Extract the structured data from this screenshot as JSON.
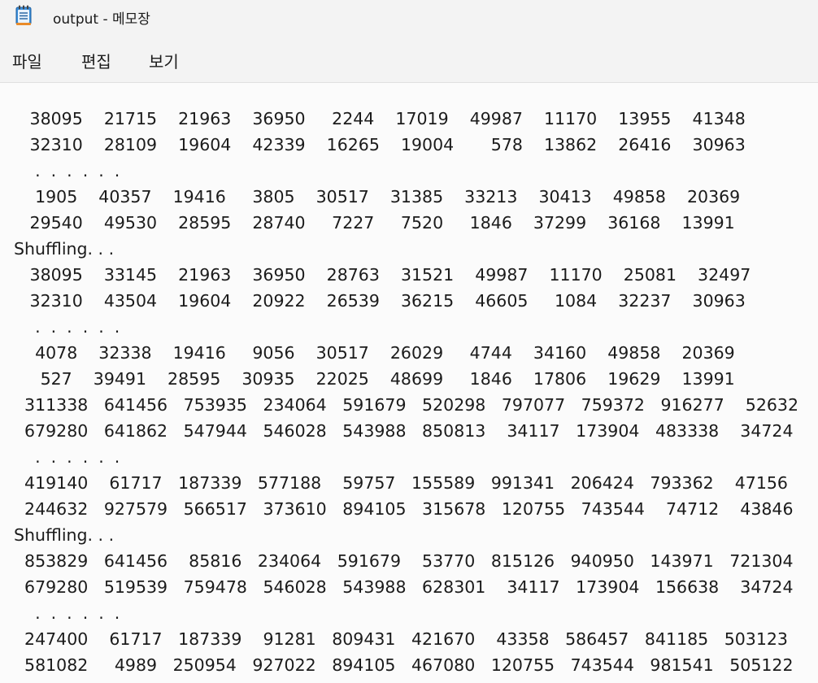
{
  "window": {
    "title": "output - 메모장",
    "icon": "notepad-icon"
  },
  "menu": {
    "file": "파일",
    "edit": "편집",
    "view": "보기"
  },
  "document": {
    "lines": [
      "   38095    21715    21963    36950     2244    17019    49987    11170    13955    41348",
      "   32310    28109    19604    42339    16265    19004       578    13862    26416    30963",
      "    .  .  .  .  .  .",
      "    1905    40357    19416     3805    30517    31385    33213    30413    49858    20369",
      "   29540    49530    28595    28740     7227     7520     1846    37299    36168    13991",
      "Shuffling. . .",
      "   38095    33145    21963    36950    28763    31521    49987    11170    25081    32497",
      "   32310    43504    19604    20922    26539    36215    46605     1084    32237    30963",
      "    .  .  .  .  .  .",
      "    4078    32338    19416     9056    30517    26029     4744    34160    49858    20369",
      "     527    39491    28595    30935    22025    48699     1846    17806    19629    13991",
      "  311338   641456   753935   234064   591679   520298   797077   759372   916277    52632",
      "  679280   641862   547944   546028   543988   850813    34117   173904   483338    34724",
      "    .  .  .  .  .  .",
      "  419140    61717   187339   577188    59757   155589   991341   206424   793362    47156",
      "  244632   927579   566517   373610   894105   315678   120755   743544    74712    43846",
      "Shuffling. . .",
      "  853829   641456    85816   234064   591679    53770   815126   940950   143971   721304",
      "  679280   519539   759478   546028   543988   628301    34117   173904   156638    34724",
      "    .  .  .  .  .  .",
      "  247400    61717   187339    91281   809431   421670    43358   586457   841185   503123",
      "  581082     4989   250954   927022   894105   467080   120755   743544   981541   505122"
    ]
  }
}
